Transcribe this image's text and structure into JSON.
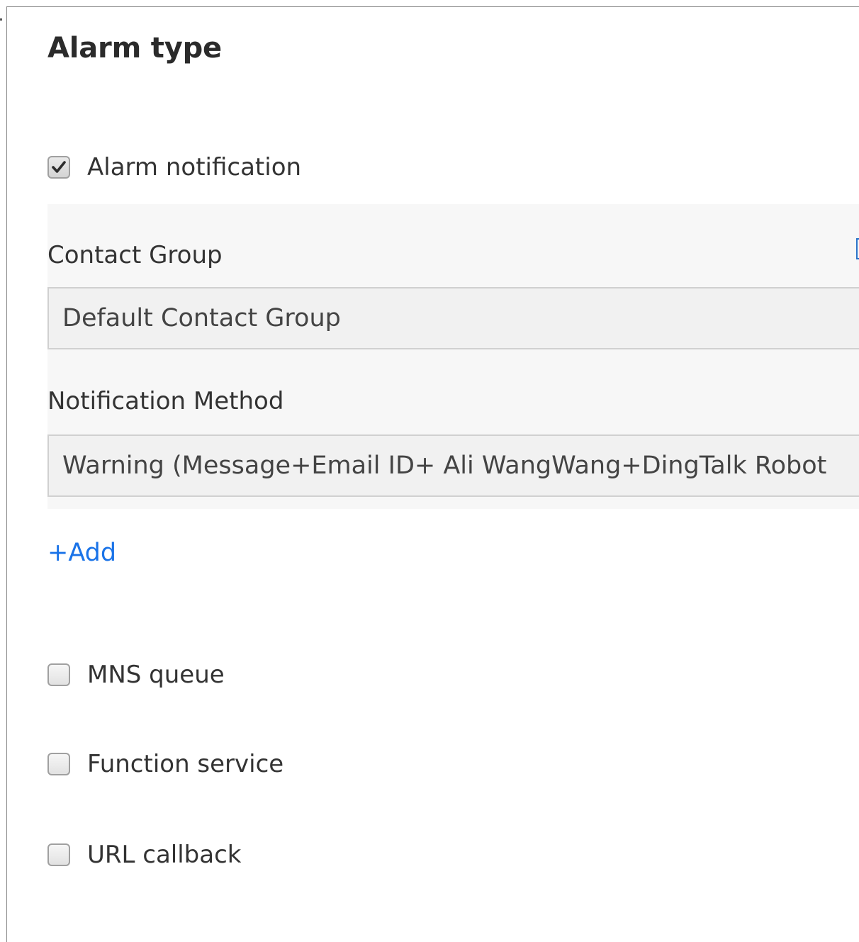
{
  "section": {
    "title": "Alarm type"
  },
  "alarm_notification": {
    "label": "Alarm notification",
    "checked": true
  },
  "contact_group": {
    "label": "Contact Group",
    "value": "Default Contact Group"
  },
  "notification_method": {
    "label": "Notification Method",
    "value": "Warning (Message+Email ID+ Ali WangWang+DingTalk Robot"
  },
  "add_link": {
    "label": "+Add"
  },
  "options": [
    {
      "label": "MNS queue",
      "checked": false
    },
    {
      "label": "Function service",
      "checked": false
    },
    {
      "label": "URL callback",
      "checked": false
    }
  ],
  "colors": {
    "link": "#1a73e8",
    "panel_bg": "#f7f7f7",
    "field_bg": "#f1f1f1",
    "field_border": "#d0d0d0"
  },
  "icons": {
    "checkbox_checked": "checkmark-icon"
  }
}
